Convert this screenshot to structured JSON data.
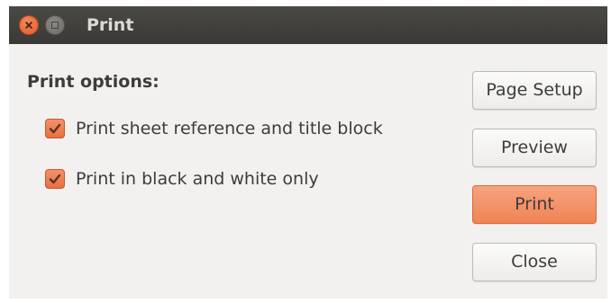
{
  "window": {
    "title": "Print"
  },
  "titlebar_icons": [
    "close-icon",
    "minimize-icon"
  ],
  "print_options": {
    "heading": "Print options:",
    "options": [
      {
        "label": "Print sheet reference and title block",
        "checked": true
      },
      {
        "label": "Print in black and white only",
        "checked": true
      }
    ]
  },
  "buttons": {
    "page_setup": "Page Setup",
    "preview": "Preview",
    "print": "Print",
    "close": "Close"
  },
  "colors": {
    "accent": "#ef8455",
    "titlebar": "#3c3b37"
  }
}
